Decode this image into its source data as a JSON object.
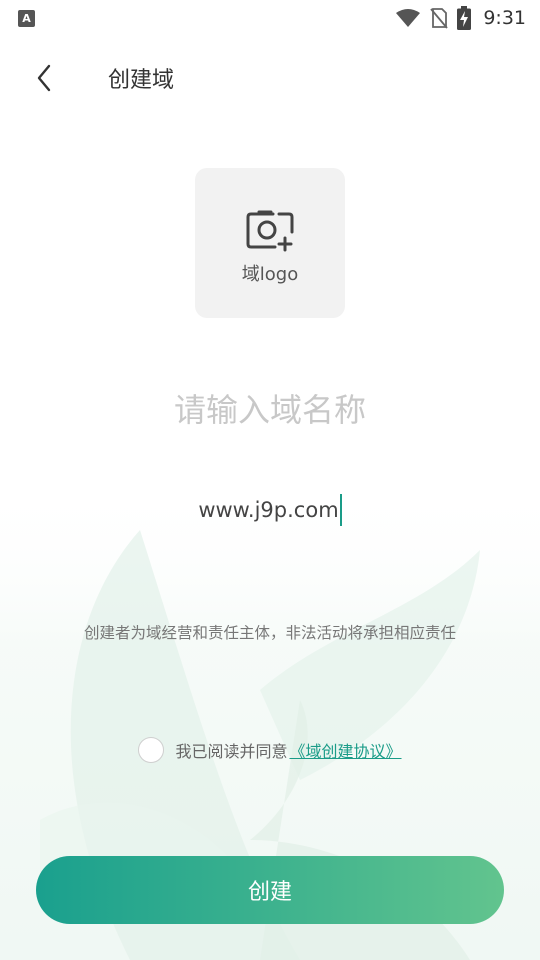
{
  "status_bar": {
    "app_badge": "A",
    "time": "9:31",
    "icons": [
      "wifi-icon",
      "no-sim-icon",
      "battery-charging-icon"
    ]
  },
  "header": {
    "title": "创建域",
    "back_icon": "chevron-left-icon"
  },
  "logo_tile": {
    "label": "域logo",
    "icon": "camera-add-icon"
  },
  "name_input": {
    "value": "",
    "placeholder": "请输入域名称"
  },
  "url": {
    "text": "www.j9p.com"
  },
  "notice": {
    "text": "创建者为域经营和责任主体，非法活动将承担相应责任"
  },
  "agreement": {
    "text": "我已阅读并同意",
    "link_text": "《域创建协议》",
    "checked": false
  },
  "create_button": {
    "label": "创建"
  },
  "colors": {
    "accent": "#1a9c88",
    "button_start": "#1aa08e",
    "button_end": "#62c48e",
    "placeholder": "#c8c8c8"
  }
}
